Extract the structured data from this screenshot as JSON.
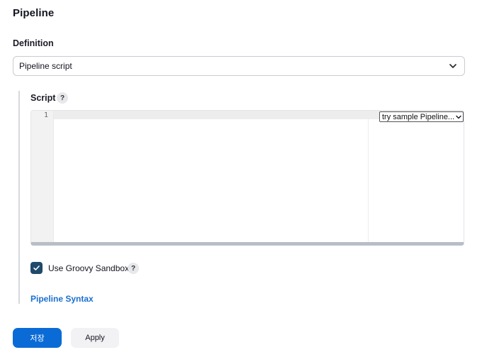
{
  "section": {
    "title": "Pipeline"
  },
  "definition": {
    "label": "Definition",
    "selected": "Pipeline script",
    "icon": "chevron-down-icon"
  },
  "script": {
    "label": "Script",
    "help": "?",
    "editor": {
      "line_numbers": [
        "1"
      ],
      "content": ""
    },
    "sample_select": {
      "selected": "try sample Pipeline...",
      "icon": "chevron-down-icon"
    }
  },
  "sandbox": {
    "label": "Use Groovy Sandbox",
    "checked": true,
    "help": "?",
    "check_color": "#1f4a6b"
  },
  "links": {
    "pipeline_syntax": "Pipeline Syntax"
  },
  "buttons": {
    "save": "저장",
    "apply": "Apply",
    "save_color": "#0b6bd6"
  }
}
